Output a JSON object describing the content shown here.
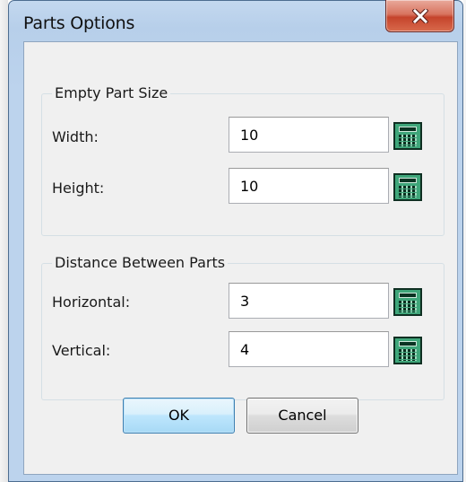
{
  "window": {
    "title": "Parts Options",
    "close_icon": "close-icon"
  },
  "groups": {
    "empty_part_size": {
      "label": "Empty Part Size",
      "width": {
        "label": "Width:",
        "value": "10"
      },
      "height": {
        "label": "Height:",
        "value": "10"
      }
    },
    "distance_between_parts": {
      "label": "Distance Between Parts",
      "horizontal": {
        "label": "Horizontal:",
        "value": "3"
      },
      "vertical": {
        "label": "Vertical:",
        "value": "4"
      }
    }
  },
  "buttons": {
    "ok": "OK",
    "cancel": "Cancel"
  },
  "icons": {
    "calculator": "calculator-icon"
  },
  "colors": {
    "title_bar": "#bcd3ed",
    "close_button": "#c5442c",
    "calculator": "#3fa67a",
    "ok_button": "#bee6fd"
  }
}
